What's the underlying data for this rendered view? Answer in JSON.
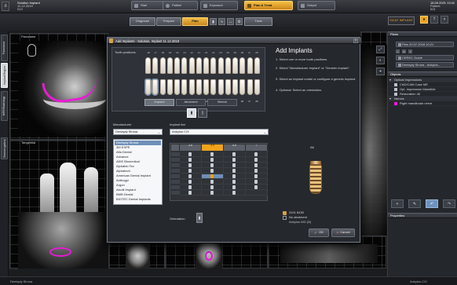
{
  "title": {
    "line1": "Solution Implant",
    "line2": "11.12.2019",
    "line3": "013"
  },
  "patient": {
    "line1": "16.09.2021 13:41",
    "line2": "Patient",
    "line3": "ID3"
  },
  "nav": {
    "steps": [
      "Start",
      "Patient",
      "Exposure",
      "Plan & Treat",
      "Output"
    ],
    "substeps": [
      "Diagnose",
      "Prepare",
      "Plan",
      "Treat"
    ]
  },
  "brand": {
    "name": "SICAT IMPLANT"
  },
  "left_tabs": [
    "Panorama",
    "Implant Region",
    "MPR/Radiology",
    "Session gallery"
  ],
  "viewers": {
    "panorama": "Panorama",
    "tangential": "Tangential"
  },
  "dialog": {
    "title": "Add Implants - Solution, Implant 11.12.2019",
    "tooth_positions": "Tooth positions",
    "upper_numbers": [
      "18",
      "17",
      "16",
      "15",
      "14",
      "13",
      "12",
      "11",
      "21",
      "22",
      "23",
      "24",
      "25",
      "26",
      "27",
      "28"
    ],
    "lower_numbers": [
      "48",
      "47",
      "46",
      "45",
      "44",
      "43",
      "42",
      "41",
      "31",
      "32",
      "33",
      "34",
      "35",
      "36",
      "37",
      "38"
    ],
    "tabs": [
      "Implant",
      "Abutment",
      "Sleeve"
    ],
    "manufacturer_label": "Manufacturer",
    "manufacturer_value": "Dentsply Sirona",
    "implant_line_label": "Implant line",
    "implant_line_value": "Ankylos C/X",
    "manufacturers": [
      "Dentsply Sirona",
      "3M ESPE",
      "Alfa Dental",
      "Advance",
      "AlDE Biomedical",
      "Alphabio Tec",
      "Alphatech",
      "American Dental Implant",
      "Anthogyr",
      "Argon",
      "Alcolil Implant",
      "BMB Dental",
      "BIOTEC Dental Implants"
    ],
    "diameters": [
      "3.5",
      "4.5",
      "5.5",
      "7"
    ],
    "orientation_label": "Orientation",
    "instructions_title": "Add Implants",
    "instructions": [
      "1. Select one or more tooth positions.",
      "2. Select \"Manufacturer implant\" or \"Generic implant\".",
      "3. Select an implant model or configure a generic implant.",
      "4. Optional: Select an orientation."
    ],
    "implant_id": "A6",
    "info": [
      "3101 8430",
      "No abutment",
      "Ankylos WD (B)"
    ],
    "ok": "OK",
    "cancel": "Cancel"
  },
  "right_panel": {
    "plans_title": "Plans",
    "plan_value": "Plan 20.07.2018 10:21",
    "guide": "CEREC Guide",
    "guide_value": "Dentsply Sirona - Ankylos...",
    "objects_title": "Objects",
    "objects": [
      "Optical Impressions",
      "CAD/CAM Case ME",
      "Opt. Impression Mandible",
      "Restoration 46",
      "Nerves",
      "Right mandibular nerve"
    ],
    "properties_title": "Properties"
  },
  "status": {
    "left": "Dentsply Sirona",
    "right": "Ankylos C/X"
  },
  "colors": {
    "accent": "#f0a21a",
    "nerve": "#e91bd6",
    "selection": "#6f8fb7"
  }
}
